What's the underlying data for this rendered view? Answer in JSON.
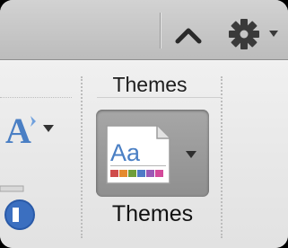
{
  "toolbar": {
    "collapse_icon": "chevron-up-icon",
    "settings_icon": "gear-icon"
  },
  "themes_group": {
    "title": "Themes",
    "button_label": "Themes",
    "thumbnail_text": "Aa",
    "icon": "themes-document-icon"
  },
  "left_tools": {
    "font_icon": "text-effects-icon",
    "style_icon": "theme-colors-icon"
  },
  "colors": {
    "accent_blue": "#4a7fc4",
    "swatches": [
      "#cf4b4b",
      "#e58a2e",
      "#6f9e3a",
      "#4e7ac7",
      "#9b59b6",
      "#d44a9a"
    ]
  }
}
